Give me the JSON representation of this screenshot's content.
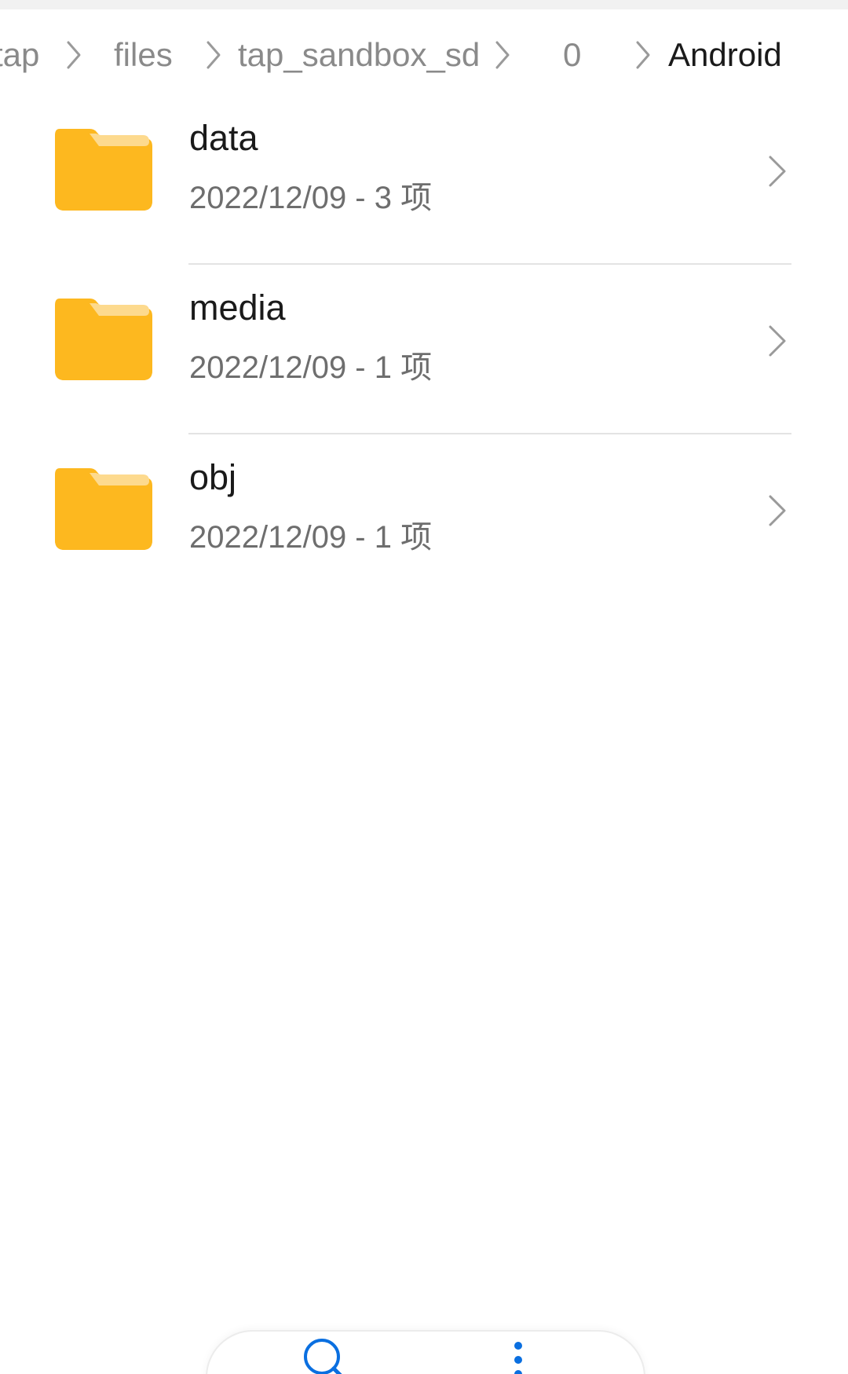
{
  "breadcrumb": {
    "items": [
      {
        "label": "tap"
      },
      {
        "label": "files"
      },
      {
        "label": "tap_sandbox_sd"
      },
      {
        "label": "0"
      },
      {
        "label": "Android"
      }
    ]
  },
  "folders": [
    {
      "name": "data",
      "meta": "2022/12/09 - 3 项"
    },
    {
      "name": "media",
      "meta": "2022/12/09 - 1 项"
    },
    {
      "name": "obj",
      "meta": "2022/12/09 - 1 项"
    }
  ],
  "icons": {
    "folder": "folder-icon",
    "chevron": "chevron-right-icon",
    "search": "search-icon",
    "more": "more-vertical-icon"
  },
  "colors": {
    "folder_main": "#FDB81F",
    "folder_tab": "#FDDA8E",
    "accent": "#0A6FE0"
  }
}
